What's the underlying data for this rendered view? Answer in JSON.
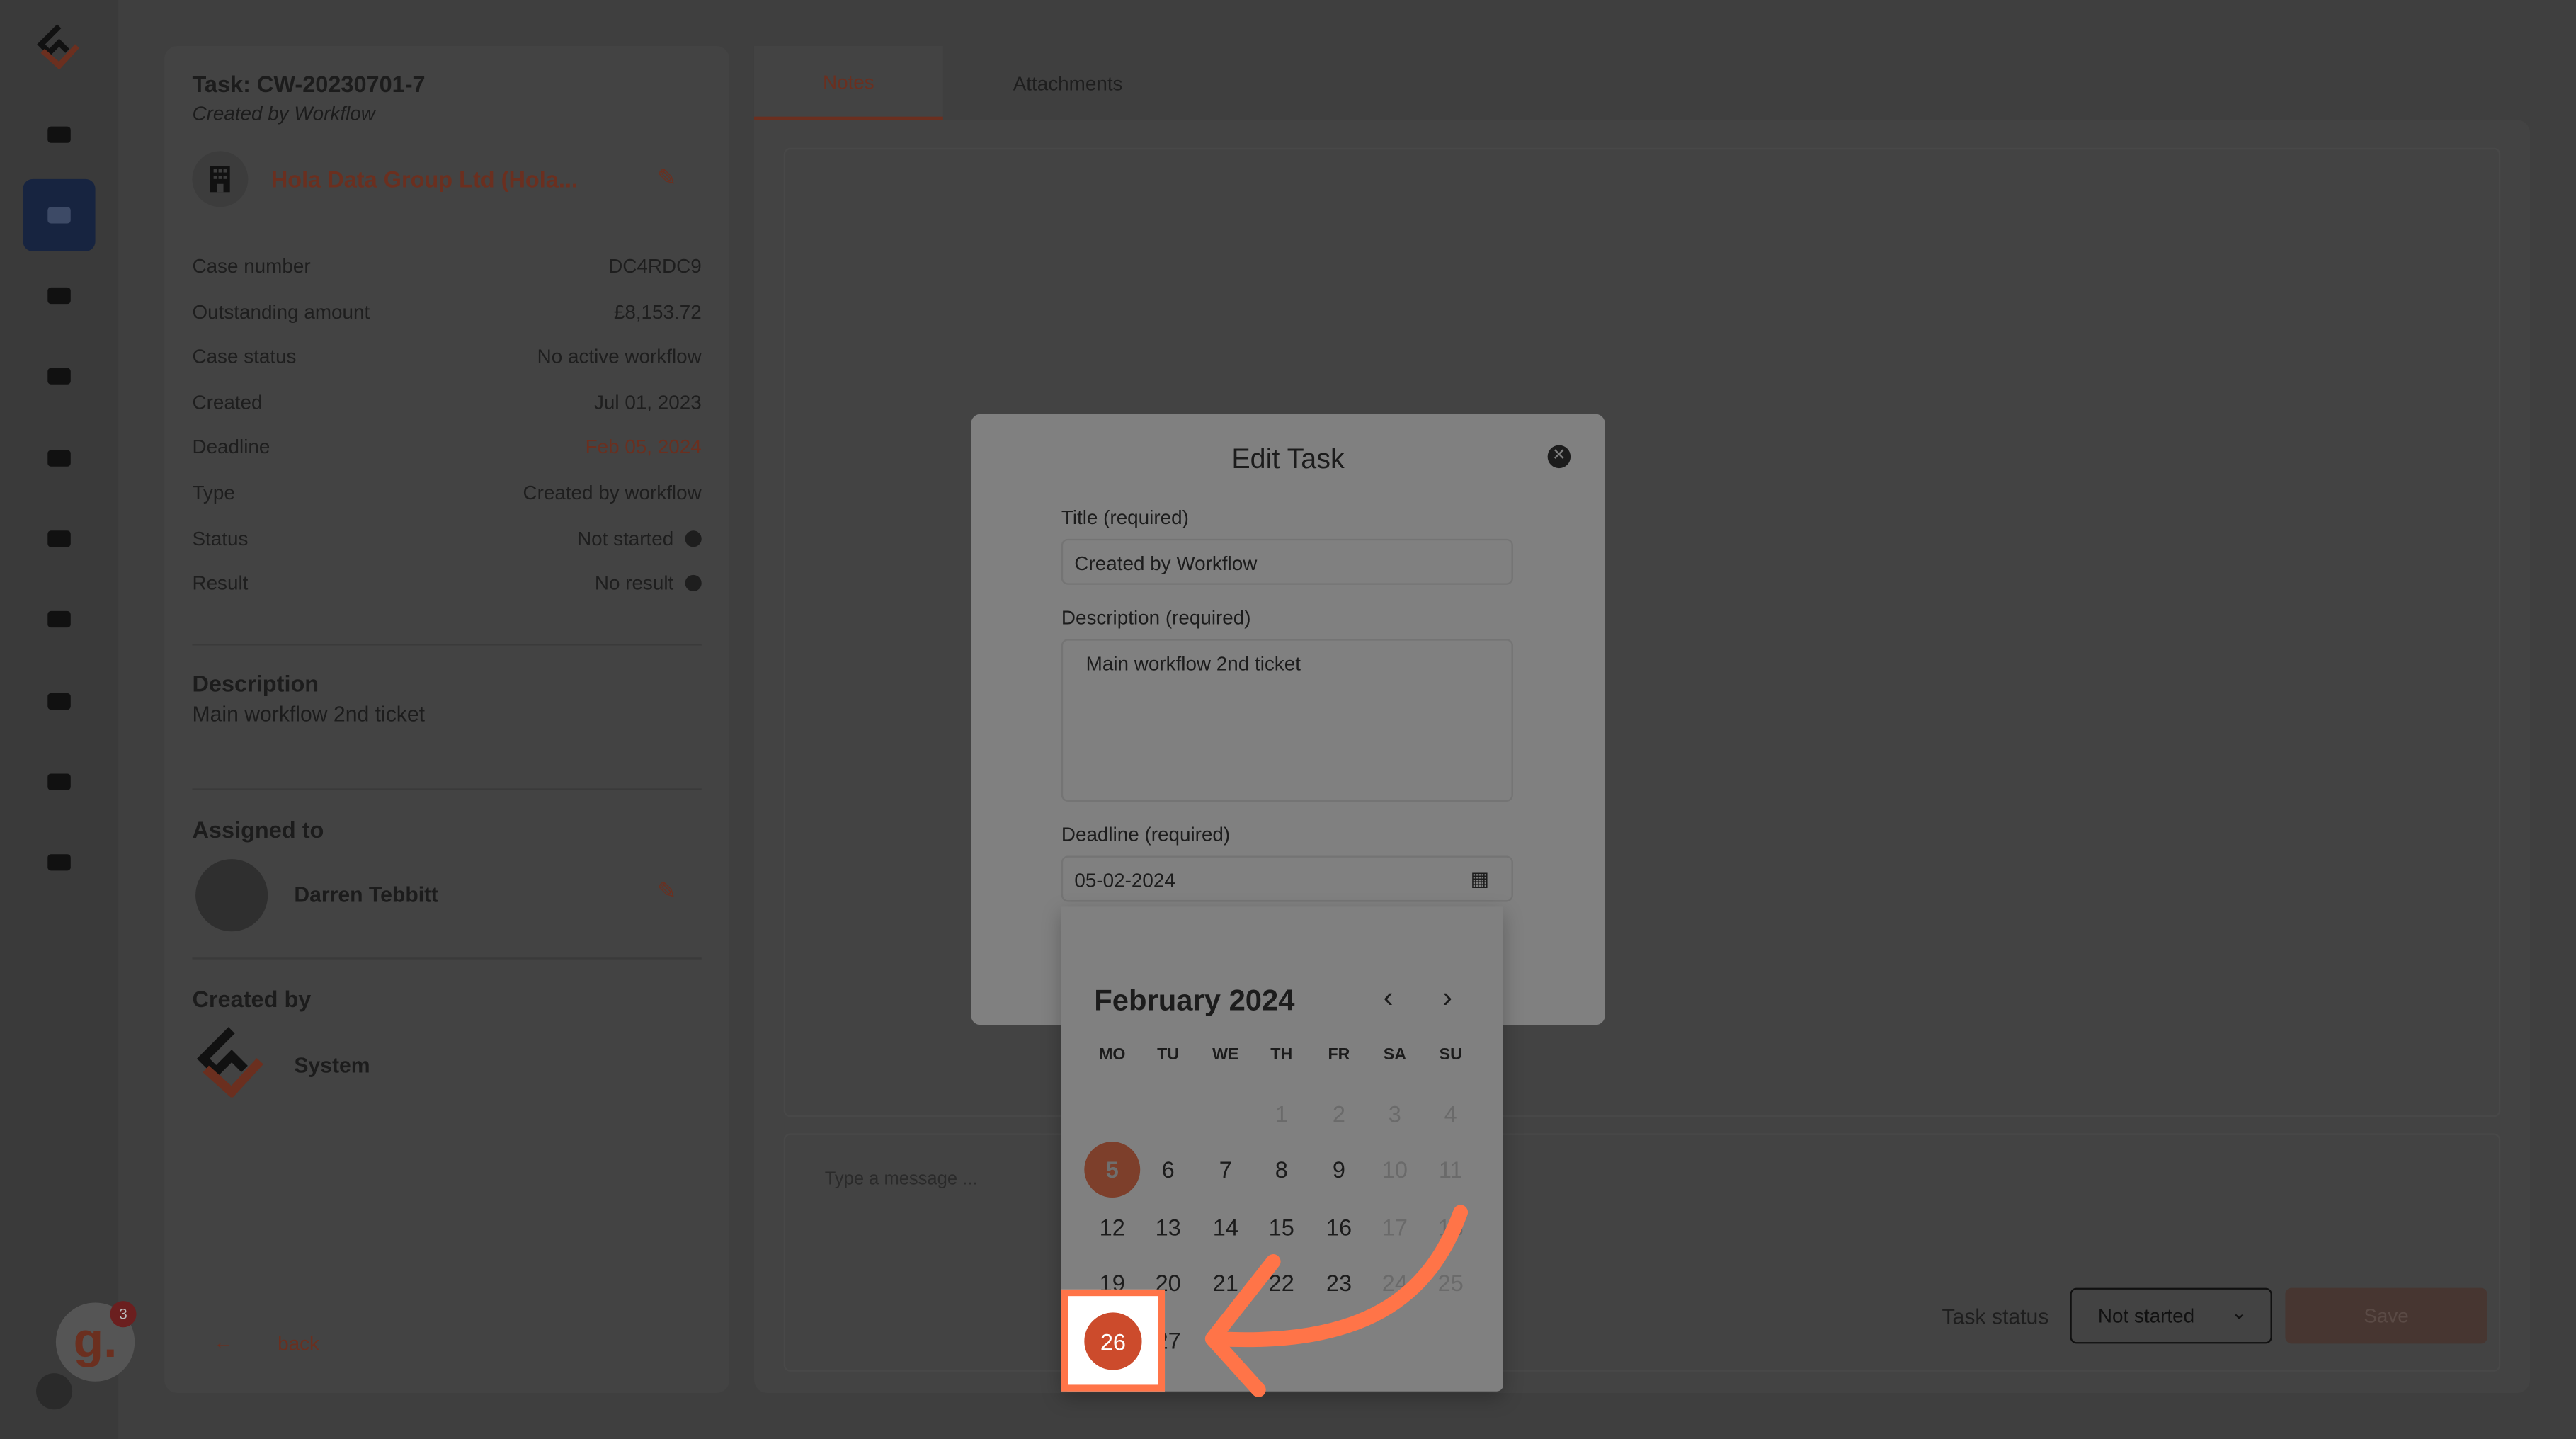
{
  "sidebar": {
    "items": [
      "home-icon",
      "ticket-icon",
      "users-icon",
      "contact-card-icon",
      "database-icon",
      "envelope-icon",
      "bank-icon",
      "branch-icon",
      "team-icon",
      "gear-icon"
    ],
    "active": "ticket-icon",
    "notification_badge": "3",
    "badge_logo": "g."
  },
  "task": {
    "title": "Task: CW-20230701-7",
    "subtitle": "Created by Workflow",
    "company": "Hola Data Group Ltd (Hola...",
    "fields": [
      {
        "label": "Case number",
        "value": "DC4RDC9"
      },
      {
        "label": "Outstanding amount",
        "value": "£8,153.72"
      },
      {
        "label": "Case status",
        "value": "No active workflow"
      },
      {
        "label": "Created",
        "value": "Jul 01, 2023"
      },
      {
        "label": "Deadline",
        "value": "Feb 05, 2024"
      },
      {
        "label": "Type",
        "value": "Created by workflow"
      },
      {
        "label": "Status",
        "value": "Not started"
      },
      {
        "label": "Result",
        "value": "No result"
      }
    ],
    "description_heading": "Description",
    "description": "Main workflow 2nd ticket",
    "assigned_heading": "Assigned to",
    "assignee": "Darren Tebbitt",
    "created_by_heading": "Created by",
    "created_by": "System",
    "back": "back"
  },
  "tabs": [
    {
      "label": "Notes",
      "active": true
    },
    {
      "label": "Attachments",
      "active": false
    }
  ],
  "composer": {
    "placeholder": "Type a message ...",
    "task_status_label": "Task status",
    "task_status_value": "Not started",
    "save": "Save"
  },
  "modal": {
    "title": "Edit Task",
    "title_label": "Title (required)",
    "title_value": "Created by Workflow",
    "description_label": "Description (required)",
    "description_value": "Main workflow 2nd ticket",
    "deadline_label": "Deadline (required)",
    "deadline_value": "05-02-2024"
  },
  "calendar": {
    "month": "February 2024",
    "weekdays": [
      "MO",
      "TU",
      "WE",
      "TH",
      "FR",
      "SA",
      "SU"
    ],
    "weeks": [
      [
        "",
        "",
        "",
        "1",
        "2",
        "3",
        "4"
      ],
      [
        "5",
        "6",
        "7",
        "8",
        "9",
        "10",
        "11"
      ],
      [
        "12",
        "13",
        "14",
        "15",
        "16",
        "17",
        "18"
      ],
      [
        "19",
        "20",
        "21",
        "22",
        "23",
        "24",
        "25"
      ],
      [
        "26",
        "27",
        "",
        "",
        "",
        "",
        ""
      ]
    ],
    "selected": "5",
    "highlighted": "26"
  },
  "colors": {
    "accent": "#cc4b2c",
    "annotation": "#ff7448",
    "active_nav": "#172440"
  }
}
